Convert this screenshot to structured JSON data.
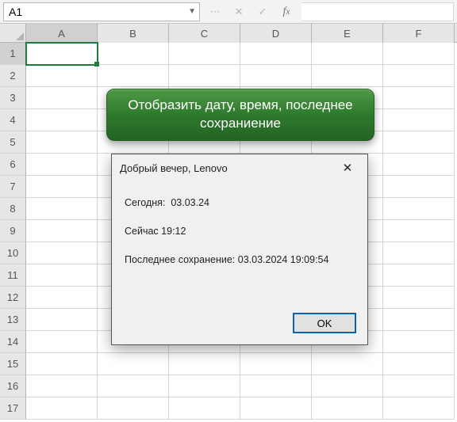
{
  "formula_bar": {
    "cell_ref": "A1",
    "formula": ""
  },
  "grid": {
    "columns": [
      "A",
      "B",
      "C",
      "D",
      "E",
      "F"
    ],
    "row_count": 17,
    "active_cell": "A1"
  },
  "callout": {
    "text": "Отобразить дату, время, последнее сохраниение"
  },
  "dialog": {
    "title": "Добрый вечер, Lenovo",
    "today_label": "Сегодня:",
    "today_value": "03.03.24",
    "now_label": "Сейчас",
    "now_value": "19:12",
    "last_save_label": "Последнее сохранение:",
    "last_save_value": "03.03.2024 19:09:54",
    "ok_label": "OK"
  }
}
